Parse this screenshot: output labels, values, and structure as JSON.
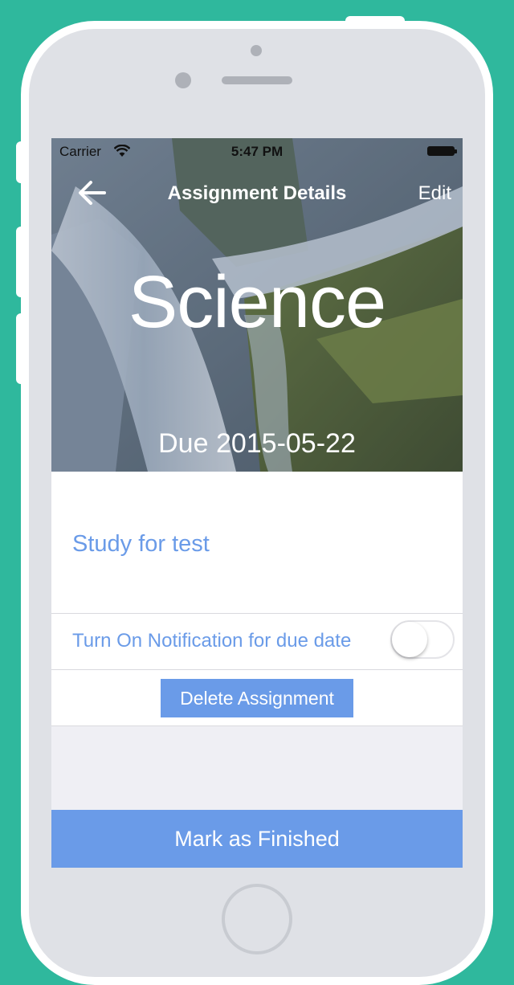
{
  "status_bar": {
    "carrier": "Carrier",
    "time": "5:47 PM"
  },
  "nav": {
    "title": "Assignment Details",
    "edit_label": "Edit",
    "back_icon": "arrow-left-icon"
  },
  "assignment": {
    "subject": "Science",
    "due": "Due 2015-05-22",
    "task": "Study for test"
  },
  "notification": {
    "label": "Turn On Notification for due date",
    "enabled": false
  },
  "actions": {
    "delete_label": "Delete Assignment",
    "finish_label": "Mark as Finished"
  },
  "colors": {
    "accent": "#6a9be8",
    "background": "#2fb89d"
  }
}
